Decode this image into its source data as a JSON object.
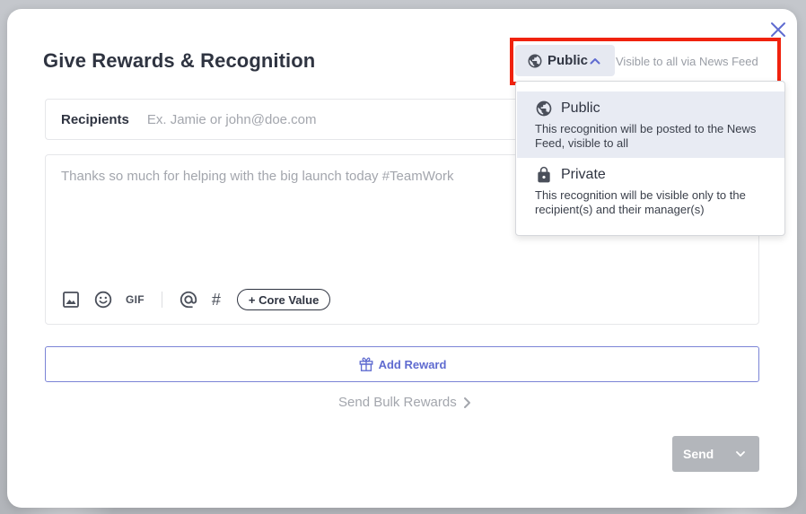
{
  "modal": {
    "title": "Give Rewards & Recognition",
    "close_icon": "close-icon"
  },
  "visibility": {
    "selected_label": "Public",
    "hint": "Visible to all via News Feed",
    "options": [
      {
        "label": "Public",
        "description": "This recognition will be posted to the News Feed, visible to all",
        "icon": "globe-icon"
      },
      {
        "label": "Private",
        "description": "This recognition will be visible only to the recipient(s) and their manager(s)",
        "icon": "lock-icon"
      }
    ]
  },
  "recipients": {
    "label": "Recipients",
    "placeholder": "Ex. Jamie or john@doe.com"
  },
  "message": {
    "placeholder": "Thanks so much for helping with the big launch today #TeamWork"
  },
  "toolbar": {
    "gif_label": "GIF",
    "hash_label": "#",
    "core_value_label": "+ Core Value"
  },
  "add_reward": {
    "label": "Add Reward"
  },
  "bulk": {
    "label": "Send Bulk Rewards"
  },
  "send": {
    "label": "Send"
  },
  "colors": {
    "accent": "#5f6bd0",
    "highlight_border": "#f0220e",
    "selected_option_bg": "#e8ebf3",
    "send_disabled": "#b3b6bb"
  }
}
